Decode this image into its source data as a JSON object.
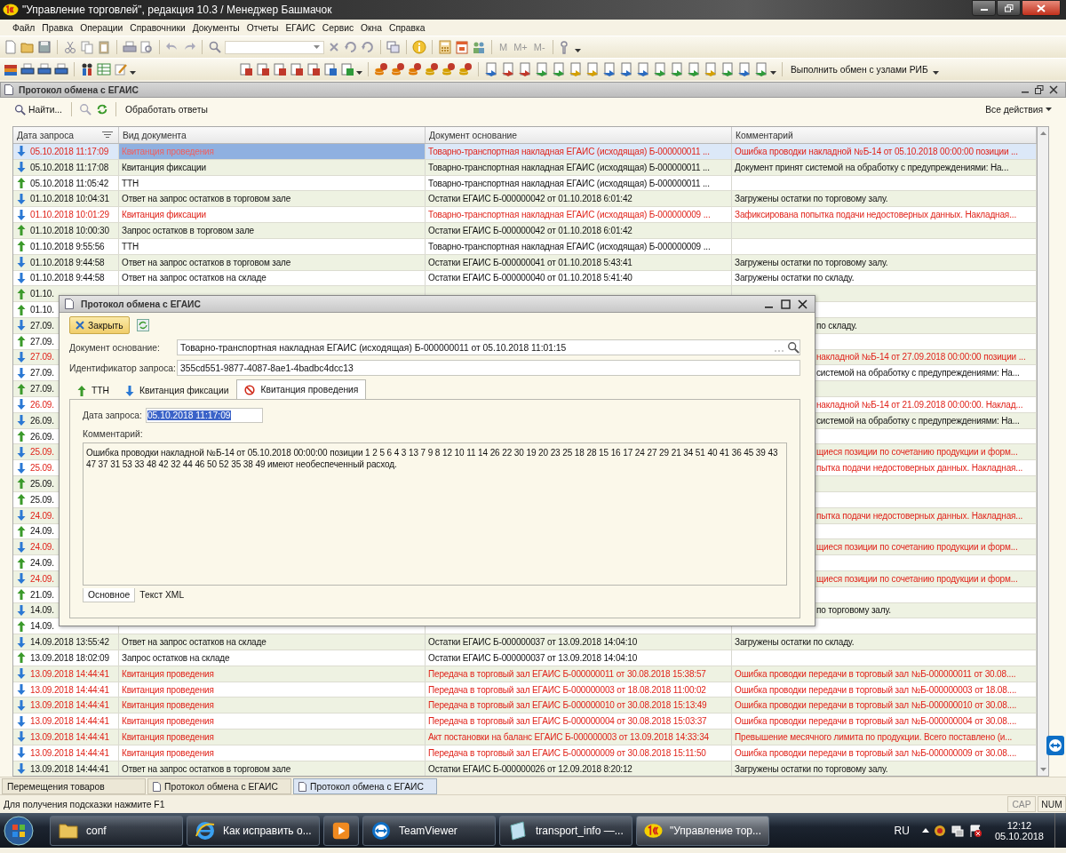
{
  "window": {
    "title": "\"Управление торговлей\", редакция 10.3 / Менеджер Башмачок"
  },
  "menu": [
    {
      "label": "Файл"
    },
    {
      "label": "Правка"
    },
    {
      "label": "Операции"
    },
    {
      "label": "Справочники"
    },
    {
      "label": "Документы"
    },
    {
      "label": "Отчеты"
    },
    {
      "label": "ЕГАИС"
    },
    {
      "label": "Сервис"
    },
    {
      "label": "Окна"
    },
    {
      "label": "Справка"
    }
  ],
  "toolbar": {
    "memory_buttons": [
      "M",
      "M+",
      "M-"
    ],
    "exchange_button": "Выполнить обмен с узлами РИБ"
  },
  "form": {
    "title": "Протокол обмена с ЕГАИС",
    "find_button": "Найти...",
    "process_button": "Обработать ответы",
    "all_actions": "Все действия"
  },
  "table": {
    "columns": [
      "Дата запроса",
      "Вид документа",
      "Документ основание",
      "Комментарий"
    ],
    "rows": [
      {
        "incoming": true,
        "error": true,
        "selected": true,
        "date": "05.10.2018 11:17:09",
        "kind": "Квитанция проведения",
        "doc": "Товарно-транспортная накладная ЕГАИС (исходящая) Б-000000011 ...",
        "comment": "Ошибка проводки накладной №Б-14 от 05.10.2018 00:00:00 позиции ..."
      },
      {
        "incoming": true,
        "error": false,
        "selected": false,
        "date": "05.10.2018 11:17:08",
        "kind": "Квитанция фиксации",
        "doc": "Товарно-транспортная накладная ЕГАИС (исходящая) Б-000000011 ...",
        "comment": "Документ принят системой на обработку с предупреждениями:  На..."
      },
      {
        "incoming": false,
        "error": false,
        "selected": false,
        "date": "05.10.2018 11:05:42",
        "kind": "ТТН",
        "doc": "Товарно-транспортная накладная ЕГАИС (исходящая) Б-000000011 ..."
      },
      {
        "incoming": true,
        "error": false,
        "selected": false,
        "date": "01.10.2018 10:04:31",
        "kind": "Ответ на запрос остатков в торговом зале",
        "doc": "Остатки ЕГАИС Б-000000042 от 01.10.2018 6:01:42",
        "comment": "Загружены остатки по торговому залу."
      },
      {
        "incoming": true,
        "error": true,
        "selected": false,
        "date": "01.10.2018 10:01:29",
        "kind": "Квитанция фиксации",
        "doc": "Товарно-транспортная накладная ЕГАИС (исходящая) Б-000000009 ...",
        "comment": "Зафиксирована попытка подачи недостоверных данных. Накладная..."
      },
      {
        "incoming": false,
        "error": false,
        "selected": false,
        "date": "01.10.2018 10:00:30",
        "kind": "Запрос остатков в торговом зале",
        "doc": "Остатки ЕГАИС Б-000000042 от 01.10.2018 6:01:42"
      },
      {
        "incoming": false,
        "error": false,
        "selected": false,
        "date": "01.10.2018 9:55:56",
        "kind": "ТТН",
        "doc": "Товарно-транспортная накладная ЕГАИС (исходящая) Б-000000009 ..."
      },
      {
        "incoming": true,
        "error": false,
        "selected": false,
        "date": "01.10.2018 9:44:58",
        "kind": "Ответ на запрос остатков в торговом зале",
        "doc": "Остатки ЕГАИС Б-000000041 от 01.10.2018 5:43:41",
        "comment": "Загружены остатки по торговому залу."
      },
      {
        "incoming": true,
        "error": false,
        "selected": false,
        "date": "01.10.2018 9:44:58",
        "kind": "Ответ на запрос остатков на складе",
        "doc": "Остатки ЕГАИС Б-000000040 от 01.10.2018 5:41:40",
        "comment": "Загружены остатки по складу."
      },
      {
        "incoming": false,
        "error": false,
        "selected": false,
        "date": "01.10."
      },
      {
        "incoming": false,
        "error": false,
        "selected": false,
        "date": "01.10."
      },
      {
        "incoming": true,
        "error": false,
        "selected": false,
        "date": "27.09.",
        "comment": "по складу."
      },
      {
        "incoming": false,
        "error": false,
        "selected": false,
        "date": "27.09."
      },
      {
        "incoming": true,
        "error": true,
        "selected": false,
        "date": "27.09.",
        "comment": "накладной №Б-14 от 27.09.2018 00:00:00 позиции ..."
      },
      {
        "incoming": true,
        "error": false,
        "selected": false,
        "date": "27.09.",
        "comment": "системой на обработку с предупреждениями:  На..."
      },
      {
        "incoming": false,
        "error": false,
        "selected": false,
        "date": "27.09."
      },
      {
        "incoming": true,
        "error": true,
        "selected": false,
        "date": "26.09.",
        "comment": "накладной №Б-14 от 21.09.2018 00:00:00. Наклад..."
      },
      {
        "incoming": true,
        "error": false,
        "selected": false,
        "date": "26.09.",
        "comment": "системой на обработку с предупреждениями:  На..."
      },
      {
        "incoming": false,
        "error": false,
        "selected": false,
        "date": "26.09."
      },
      {
        "incoming": true,
        "error": true,
        "selected": false,
        "date": "25.09.",
        "comment": "щиеся позиции по сочетанию продукции и форм..."
      },
      {
        "incoming": true,
        "error": true,
        "selected": false,
        "date": "25.09.",
        "comment": "пытка подачи недостоверных данных. Накладная..."
      },
      {
        "incoming": false,
        "error": false,
        "selected": false,
        "date": "25.09."
      },
      {
        "incoming": false,
        "error": false,
        "selected": false,
        "date": "25.09."
      },
      {
        "incoming": true,
        "error": true,
        "selected": false,
        "date": "24.09.",
        "comment": "пытка подачи недостоверных данных. Накладная..."
      },
      {
        "incoming": false,
        "error": false,
        "selected": false,
        "date": "24.09."
      },
      {
        "incoming": true,
        "error": true,
        "selected": false,
        "date": "24.09.",
        "comment": "щиеся позиции по сочетанию продукции и форм..."
      },
      {
        "incoming": false,
        "error": false,
        "selected": false,
        "date": "24.09."
      },
      {
        "incoming": true,
        "error": true,
        "selected": false,
        "date": "24.09.",
        "comment": "щиеся позиции по сочетанию продукции и форм..."
      },
      {
        "incoming": false,
        "error": false,
        "selected": false,
        "date": "21.09."
      },
      {
        "incoming": true,
        "error": false,
        "selected": false,
        "date": "14.09.",
        "comment": "по торговому залу."
      },
      {
        "incoming": false,
        "error": false,
        "selected": false,
        "date": "14.09."
      },
      {
        "incoming": true,
        "error": false,
        "selected": false,
        "date": "14.09.2018 13:55:42",
        "kind": "Ответ на запрос остатков на складе",
        "doc": "Остатки ЕГАИС Б-000000037 от 13.09.2018 14:04:10",
        "comment": "Загружены остатки по складу."
      },
      {
        "incoming": false,
        "error": false,
        "selected": false,
        "date": "13.09.2018 18:02:09",
        "kind": "Запрос остатков на складе",
        "doc": "Остатки ЕГАИС Б-000000037 от 13.09.2018 14:04:10"
      },
      {
        "incoming": true,
        "error": true,
        "selected": false,
        "date": "13.09.2018 14:44:41",
        "kind": "Квитанция проведения",
        "doc": "Передача в торговый зал ЕГАИС Б-000000011 от 30.08.2018 15:38:57",
        "comment": "Ошибка проводки передачи в торговый зал №Б-000000011 от 30.08...."
      },
      {
        "incoming": true,
        "error": true,
        "selected": false,
        "date": "13.09.2018 14:44:41",
        "kind": "Квитанция проведения",
        "doc": "Передача в торговый зал ЕГАИС Б-000000003 от 18.08.2018 11:00:02",
        "comment": "Ошибка проводки передачи в торговый зал №Б-000000003 от 18.08...."
      },
      {
        "incoming": true,
        "error": true,
        "selected": false,
        "date": "13.09.2018 14:44:41",
        "kind": "Квитанция проведения",
        "doc": "Передача в торговый зал ЕГАИС Б-000000010 от 30.08.2018 15:13:49",
        "comment": "Ошибка проводки передачи в торговый зал №Б-000000010 от 30.08...."
      },
      {
        "incoming": true,
        "error": true,
        "selected": false,
        "date": "13.09.2018 14:44:41",
        "kind": "Квитанция проведения",
        "doc": "Передача в торговый зал ЕГАИС Б-000000004 от 30.08.2018 15:03:37",
        "comment": "Ошибка проводки передачи в торговый зал №Б-000000004 от 30.08...."
      },
      {
        "incoming": true,
        "error": true,
        "selected": false,
        "date": "13.09.2018 14:44:41",
        "kind": "Квитанция проведения",
        "doc": "Акт постановки на баланс ЕГАИС Б-000000003 от 13.09.2018 14:33:34",
        "comment": "Превышение месячного лимита по продукции. Всего поставлено (и..."
      },
      {
        "incoming": true,
        "error": true,
        "selected": false,
        "date": "13.09.2018 14:44:41",
        "kind": "Квитанция проведения",
        "doc": "Передача в торговый зал ЕГАИС Б-000000009 от 30.08.2018 15:11:50",
        "comment": "Ошибка проводки передачи в торговый зал №Б-000000009 от 30.08...."
      },
      {
        "incoming": true,
        "error": false,
        "selected": false,
        "date": "13.09.2018 14:44:41",
        "kind": "Ответ на запрос остатков в торговом зале",
        "doc": "Остатки ЕГАИС Б-000000026 от 12.09.2018 8:20:12",
        "comment": "Загружены остатки по торговому залу."
      }
    ]
  },
  "dialog": {
    "title": "Протокол обмена с ЕГАИС",
    "close_button": "Закрыть",
    "fields": [
      {
        "label": "Документ основание:",
        "value": "Товарно-транспортная накладная ЕГАИС (исходящая) Б-000000011 от 05.10.2018 11:01:15",
        "kind": "reference"
      },
      {
        "label": "Идентификатор запроса:",
        "value": "355cd551-9877-4087-8ae1-4badbc4dcc13",
        "kind": "text"
      }
    ],
    "tabs": [
      {
        "label": "ТТН",
        "kind": "out",
        "selected": false
      },
      {
        "label": "Квитанция фиксации",
        "kind": "in",
        "selected": false
      },
      {
        "label": "Квитанция проведения",
        "kind": "error",
        "selected": true
      }
    ],
    "date_label": "Дата запроса:",
    "date_value": "05.10.2018 11:17:09",
    "comment_label": "Комментарий:",
    "comment": "Ошибка проводки накладной №Б-14 от 05.10.2018 00:00:00 позиции 1 2 5 6 4 3 13 7 9 8 12 10 11 14 26 22 30 19 20 23 25 18 28 15 16 17 24 27 29 21 34 51 40 41 36 45 39 43 47 37 31 53 33 48 42 32 44 46 50 52 35 38 49  имеют необеспеченный расход.",
    "bottom_tabs": [
      {
        "label": "Основное",
        "selected": true
      },
      {
        "label": "Текст XML",
        "selected": false
      }
    ]
  },
  "window_tabs": [
    {
      "label": "Перемещения товаров",
      "selected": false
    },
    {
      "label": "Протокол обмена с ЕГАИС",
      "selected": false
    },
    {
      "label": "Протокол обмена с ЕГАИС",
      "selected": true
    }
  ],
  "status_bar": {
    "hint": "Для получения подсказки нажмите F1",
    "indicators": [
      "CAP",
      "NUM"
    ]
  },
  "taskbar": {
    "items": [
      {
        "label": "conf",
        "kind": "folder",
        "active": false
      },
      {
        "label": "Как исправить о...",
        "kind": "browser",
        "active": false
      },
      {
        "kind": "media",
        "active": false
      },
      {
        "label": "TeamViewer",
        "kind": "remote",
        "active": false
      },
      {
        "label": "transport_info —...",
        "kind": "notepad",
        "active": false
      },
      {
        "label": "\"Управление тор...",
        "kind": "onec",
        "active": true
      }
    ],
    "language": "RU",
    "time": "12:12",
    "date": "05.10.2018"
  }
}
